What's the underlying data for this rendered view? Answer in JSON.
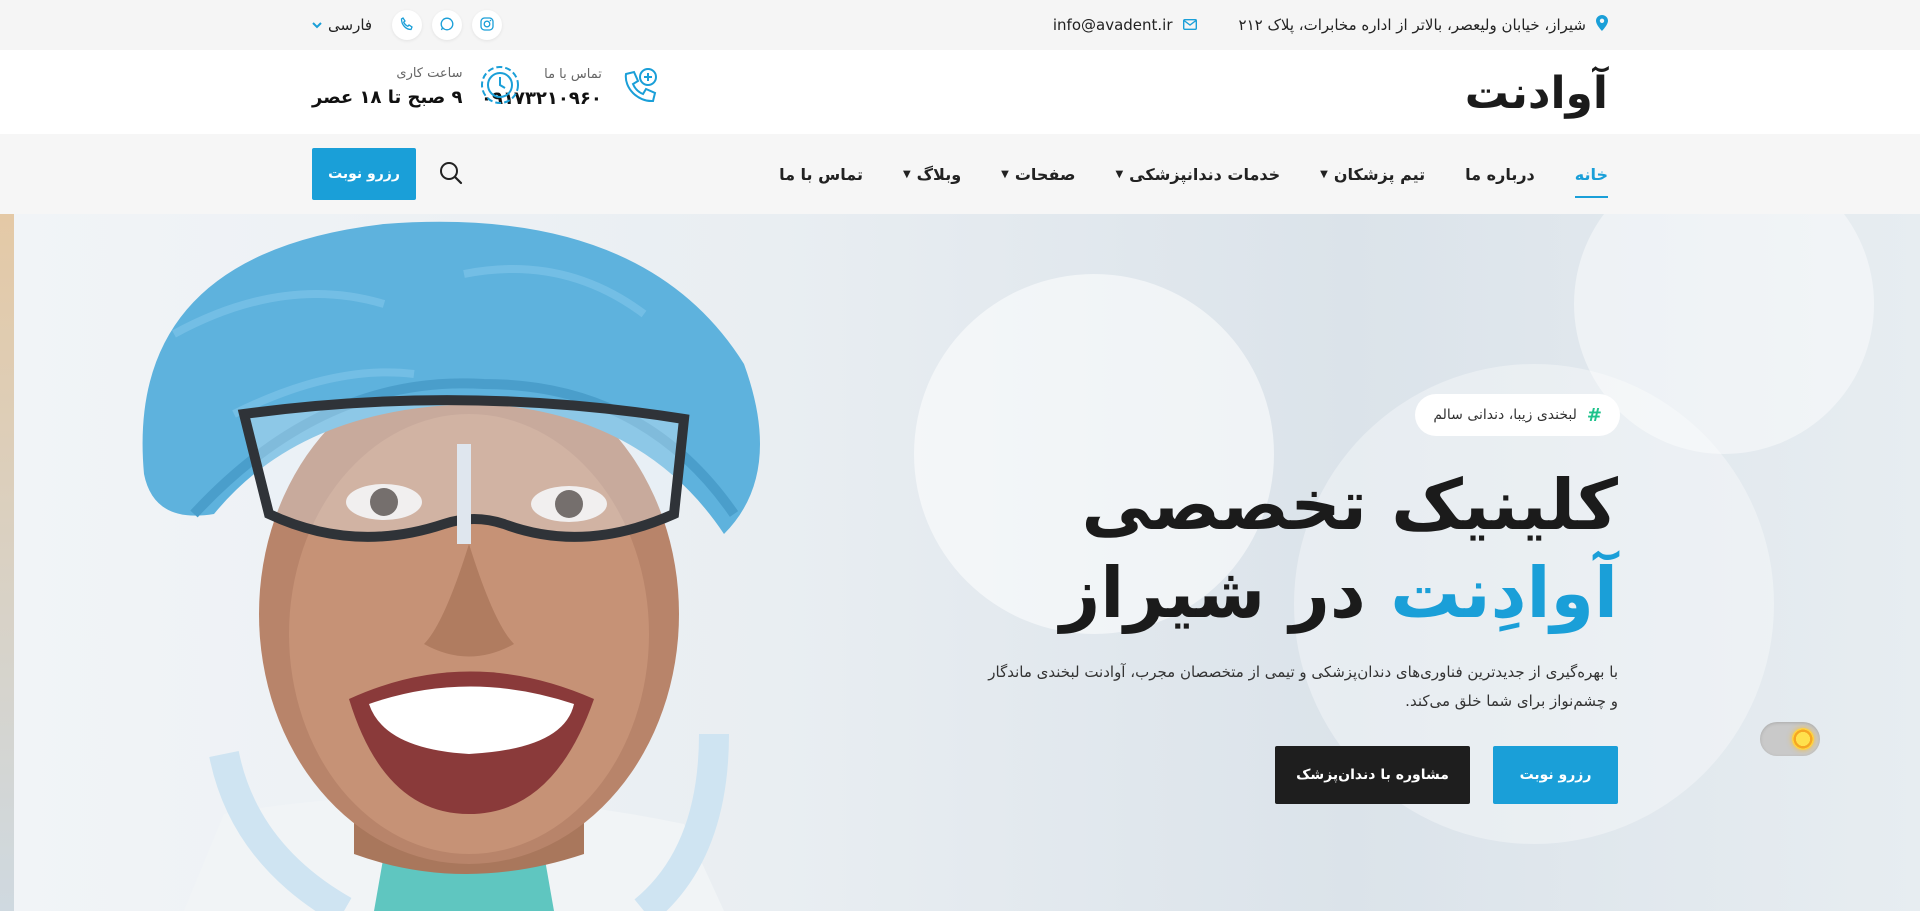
{
  "topbar": {
    "address": "شیراز، خیابان ولیعصر، بالاتر از اداره مخابرات، پلاک ۲۱۲",
    "email": "info@avadent.ir",
    "language": "فارسی",
    "social": [
      "instagram-icon",
      "whatsapp-icon",
      "phone-icon"
    ]
  },
  "header": {
    "logo": "آوادنت",
    "contact_label": "تماس با ما",
    "contact_value": "۰۹۱۷۳۲۱۰۹۶۰",
    "hours_label": "ساعت کاری",
    "hours_value": "۹ صبح تا ۱۸ عصر"
  },
  "nav": {
    "items": [
      {
        "label": "خانه",
        "active": true,
        "dropdown": false
      },
      {
        "label": "درباره ما",
        "active": false,
        "dropdown": false
      },
      {
        "label": "تیم پزشکان",
        "active": false,
        "dropdown": true
      },
      {
        "label": "خدمات دندانپزشکی",
        "active": false,
        "dropdown": true
      },
      {
        "label": "صفحات",
        "active": false,
        "dropdown": true
      },
      {
        "label": "وبلاگ",
        "active": false,
        "dropdown": true
      },
      {
        "label": "تماس با ما",
        "active": false,
        "dropdown": false
      }
    ],
    "book_label": "رزرو نوبت"
  },
  "hero": {
    "tag": "لبخندی زیبا، دندانی سالم",
    "title_line1": "کلینیک تخصصی",
    "title_highlight": "آوادِنت",
    "title_line2_rest": "در شیراز",
    "description": "با بهره‌گیری از جدیدترین فناوری‌های دندان‌پزشکی و تیمی از متخصصان مجرب، آوادنت لبخندی ماندگار و چشم‌نواز برای شما خلق می‌کند.",
    "btn_primary": "رزرو نوبت",
    "btn_secondary": "مشاوره با دندان‌پزشک"
  },
  "colors": {
    "accent": "#1a9fd8",
    "dark": "#1e1e1e",
    "tag_hash": "#1ec28b"
  }
}
